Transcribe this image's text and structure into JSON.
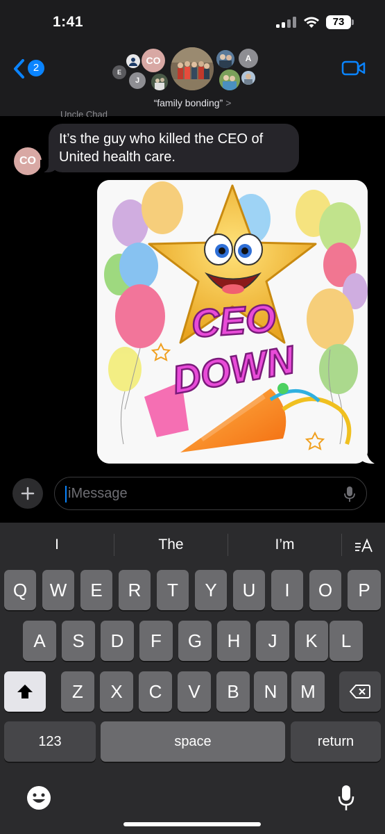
{
  "status": {
    "time": "1:41",
    "battery": "73"
  },
  "header": {
    "back_badge": "2",
    "group_name": "“family bonding”",
    "group_chevron": ">",
    "avatars": [
      {
        "initials": "E"
      },
      {
        "initials": "CO"
      },
      {
        "initials": "J"
      },
      {
        "initials": "A"
      }
    ]
  },
  "messages": [
    {
      "sender": "Uncle Chad",
      "avatar": "CO",
      "text": "It’s the guy who killed the CEO of United  health care.",
      "direction": "incoming"
    },
    {
      "image": "star-ceo-down-celebration",
      "image_text": [
        "CEO",
        "DOWN"
      ],
      "direction": "outgoing"
    }
  ],
  "composer": {
    "placeholder": "iMessage"
  },
  "keyboard": {
    "suggestions": [
      "I",
      "The",
      "I’m"
    ],
    "row1": [
      "Q",
      "W",
      "E",
      "R",
      "T",
      "Y",
      "U",
      "I",
      "O",
      "P"
    ],
    "row2": [
      "A",
      "S",
      "D",
      "F",
      "G",
      "H",
      "J",
      "K",
      "L"
    ],
    "row3": [
      "Z",
      "X",
      "C",
      "V",
      "B",
      "N",
      "M"
    ],
    "numbers": "123",
    "space": "space",
    "return": "return"
  },
  "colors": {
    "accent": "#0a84ff",
    "bubble_in": "#26252a",
    "keyboard_bg": "#2b2b2d"
  }
}
